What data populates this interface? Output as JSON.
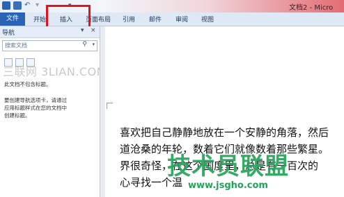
{
  "window": {
    "title": "文档2 - Micro"
  },
  "quick_access": {
    "icons": [
      "word-icon",
      "save-icon",
      "undo-icon",
      "redo-icon",
      "customize-icon"
    ]
  },
  "ribbon": {
    "file_tab": "文件",
    "tabs": [
      "开始",
      "插入",
      "页面布局",
      "引用",
      "邮件",
      "审阅",
      "视图"
    ]
  },
  "navigation_pane": {
    "title": "导航",
    "close": "×",
    "pin": "▾",
    "search_placeholder": "搜索文档",
    "empty_message": "此文档不包含标题。",
    "instructions": [
      "要创建导航选项卡，请通过",
      "应用标题样式在您的文档中",
      "创建标题。"
    ]
  },
  "watermarks": {
    "site_cn": "三联网 3LIAN.COM",
    "site_brand": "技术员联盟",
    "site_url": "www.jsgho.com"
  },
  "document": {
    "lines": [
      "喜欢把自己静静地放在一个安静的角落，然后",
      "道沧桑的年轮，数着它们就像数着那些繁星。",
      "界很奇怪，在这个国度里，总是有一百次的",
      "心寻找一个温"
    ]
  },
  "colors": {
    "file_tab": "#2a62b5",
    "highlight": "#e0141e",
    "watermark_green": "#23a35a"
  }
}
